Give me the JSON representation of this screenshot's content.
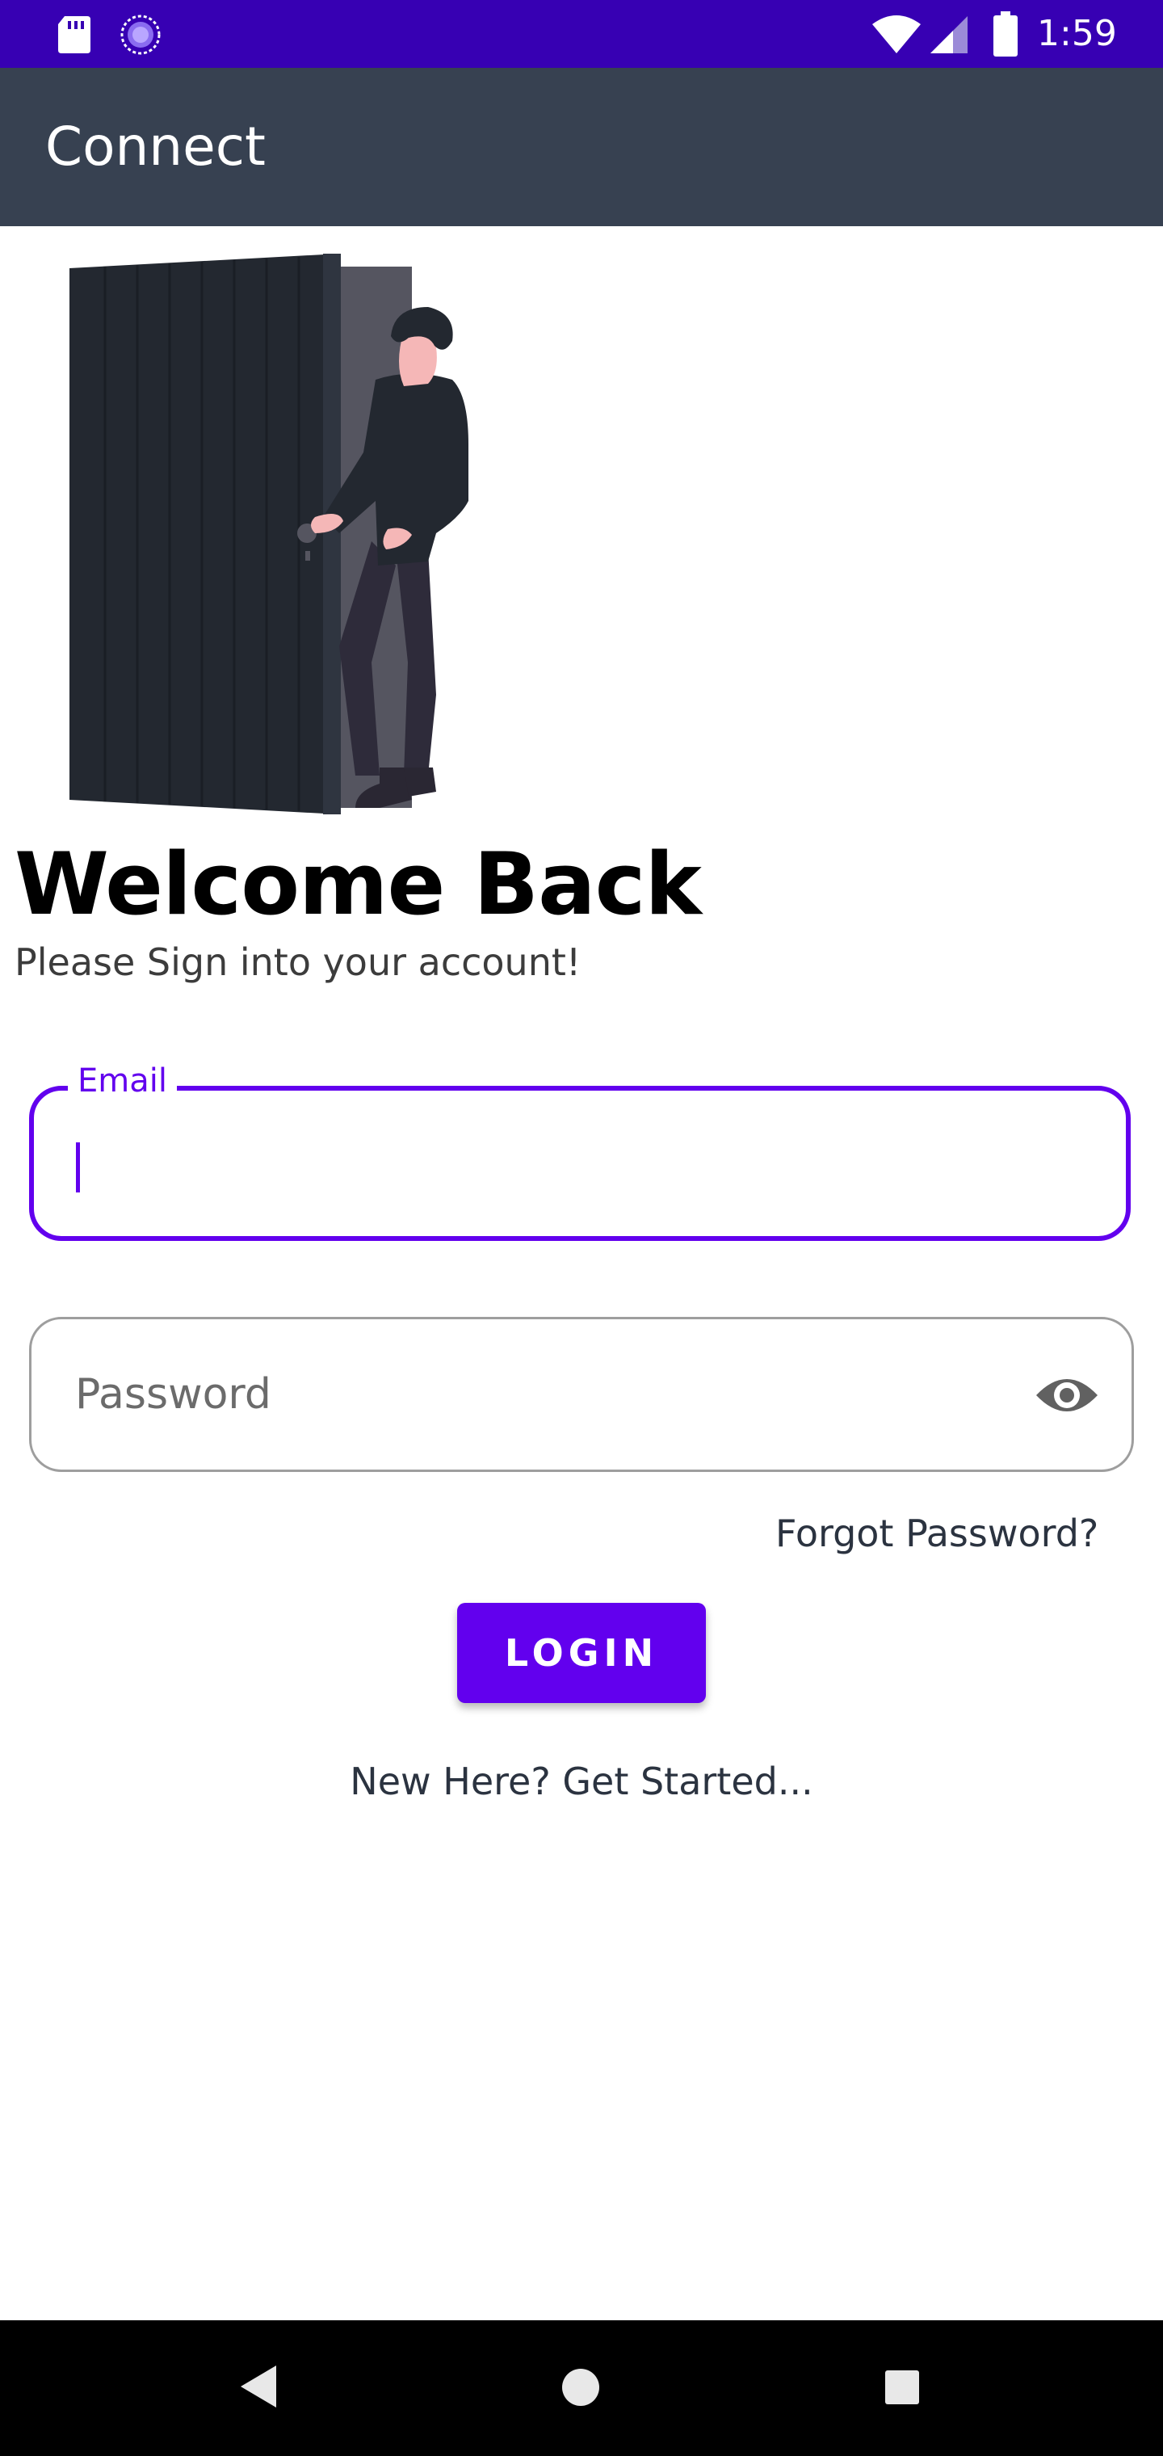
{
  "status_bar": {
    "time": "1:59",
    "icons": [
      "sd-card-icon",
      "sync-icon",
      "wifi-icon",
      "signal-icon",
      "battery-icon"
    ],
    "background": "#3700b3"
  },
  "app_bar": {
    "title": "Connect",
    "background": "#374151"
  },
  "illustration": {
    "description_icon": "person-at-door-illustration"
  },
  "welcome": {
    "heading": "Welcome Back",
    "subtitle": "Please Sign into your account!"
  },
  "form": {
    "email_label": "Email",
    "email_value": "",
    "password_placeholder": "Password",
    "password_toggle_icon": "eye-icon",
    "forgot_password": "Forgot Password?",
    "login_button": "LOGIN",
    "signup_link": "New Here? Get Started..."
  },
  "colors": {
    "accent": "#6200ee",
    "text_dark": "#2b3340"
  },
  "nav_bar": {
    "icons": [
      "back-icon",
      "home-icon",
      "recents-icon"
    ]
  }
}
